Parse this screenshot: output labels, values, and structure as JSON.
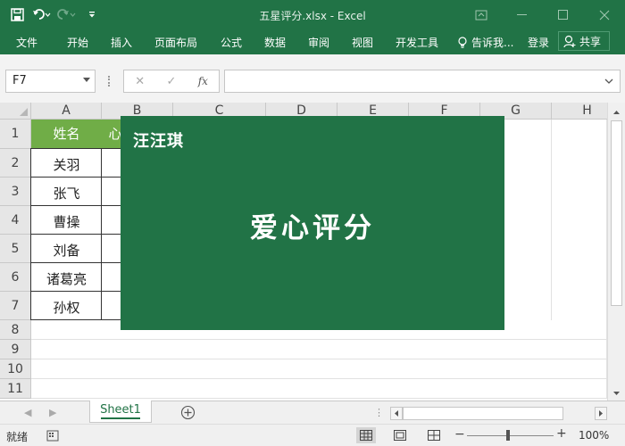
{
  "window": {
    "title": "五星评分.xlsx - Excel"
  },
  "ribbon": {
    "tabs": [
      "文件",
      "开始",
      "插入",
      "页面布局",
      "公式",
      "数据",
      "审阅",
      "视图",
      "开发工具"
    ],
    "tell_me": "告诉我...",
    "login": "登录",
    "share": "共享"
  },
  "formula_bar": {
    "name_box": "F7",
    "fx_label": "fx",
    "value": ""
  },
  "grid": {
    "columns": [
      "A",
      "B",
      "C",
      "D",
      "E",
      "F",
      "G",
      "H"
    ],
    "rows": [
      "1",
      "2",
      "3",
      "4",
      "5",
      "6",
      "7",
      "8",
      "9",
      "10",
      "11"
    ],
    "header_cells": [
      "姓名",
      "心"
    ],
    "names": [
      "关羽",
      "张飞",
      "曹操",
      "刘备",
      "诸葛亮",
      "孙权"
    ]
  },
  "banner": {
    "brand": "汪汪琪",
    "headline": "爱心评分"
  },
  "sheets": {
    "tabs": [
      "Sheet1"
    ],
    "active": "Sheet1"
  },
  "status": {
    "mode": "就绪",
    "zoom": "100%",
    "zoom_level": 100
  },
  "colors": {
    "excel_green": "#217346",
    "header_green": "#70ad47",
    "banner_green": "#217346"
  }
}
